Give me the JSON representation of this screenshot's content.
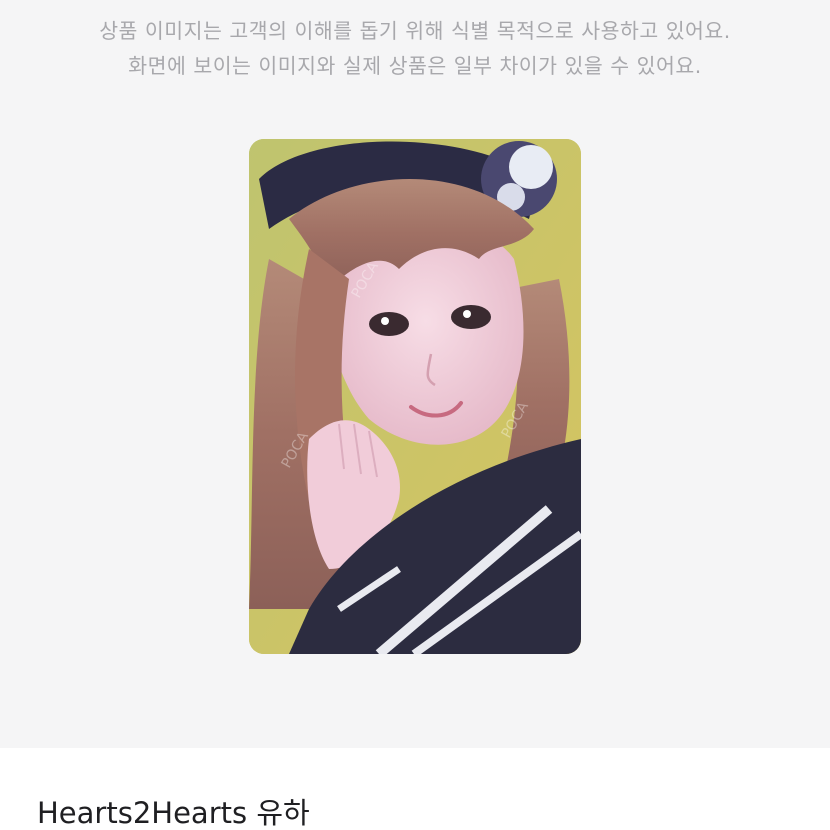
{
  "notice": {
    "line1": "상품 이미지는 고객의 이해를 돕기 위해 식별 목적으로 사용하고 있어요.",
    "line2": "화면에 보이는 이미지와 실제 상품은 일부 차이가 있을 수 있어요."
  },
  "product": {
    "title": "Hearts2Hearts 유하"
  },
  "photocard": {
    "watermark": "POCA"
  },
  "colors": {
    "notice_text": "#a8a8ac",
    "panel_background": "#f5f5f6",
    "title_text": "#1f1f22"
  }
}
